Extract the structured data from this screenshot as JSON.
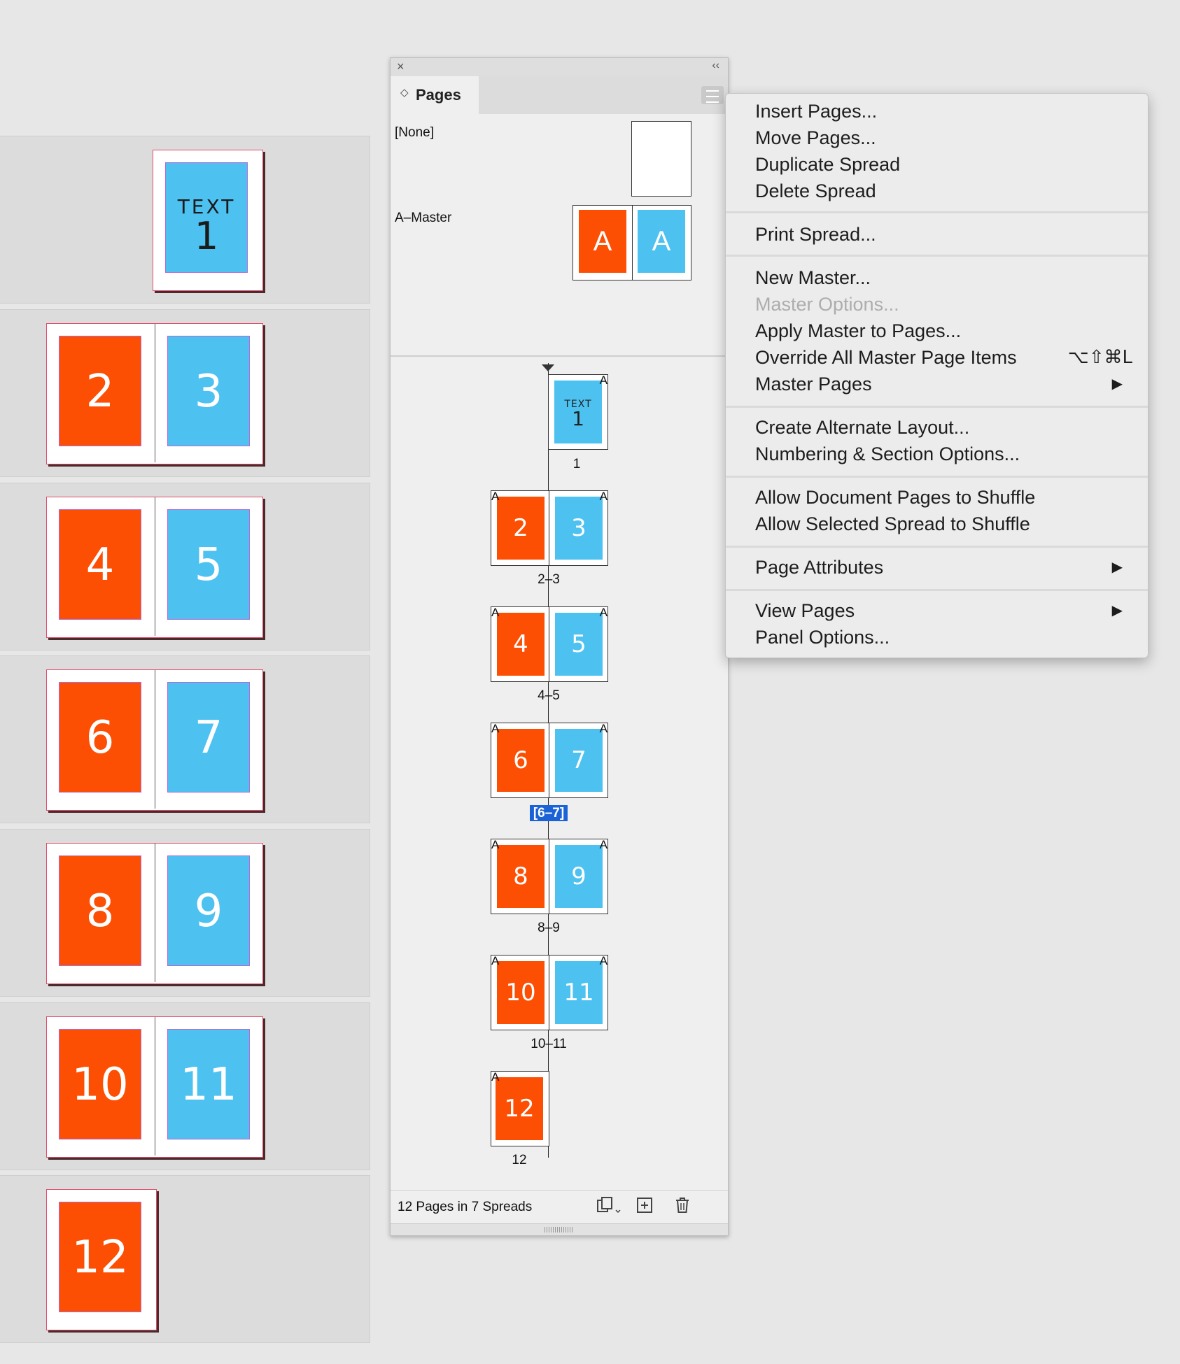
{
  "canvas": {
    "spreads": [
      {
        "pages": [
          {
            "type": "text",
            "line1": "TEXT",
            "line2": "1",
            "color": "blue"
          }
        ]
      },
      {
        "pages": [
          {
            "label": "2",
            "color": "orange"
          },
          {
            "label": "3",
            "color": "blue"
          }
        ]
      },
      {
        "pages": [
          {
            "label": "4",
            "color": "orange"
          },
          {
            "label": "5",
            "color": "blue"
          }
        ]
      },
      {
        "pages": [
          {
            "label": "6",
            "color": "orange"
          },
          {
            "label": "7",
            "color": "blue"
          }
        ]
      },
      {
        "pages": [
          {
            "label": "8",
            "color": "orange"
          },
          {
            "label": "9",
            "color": "blue"
          }
        ]
      },
      {
        "pages": [
          {
            "label": "10",
            "color": "orange"
          },
          {
            "label": "11",
            "color": "blue"
          }
        ]
      },
      {
        "pages": [
          {
            "label": "12",
            "color": "orange"
          }
        ]
      }
    ]
  },
  "colors": {
    "orange": "#fd4f04",
    "blue": "#4dc1ef",
    "selection": "#1a62d6"
  },
  "panel": {
    "close": "×",
    "collapse": "‹‹",
    "tab_arrows": "◇",
    "tab_label": "Pages",
    "none_label": "[None]",
    "master_label": "A–Master",
    "master_left": "A",
    "master_right": "A",
    "master_letter": "A",
    "thumb_text": "TEXT",
    "spreads": [
      {
        "left": "",
        "right": "1",
        "label": "1",
        "selected": false
      },
      {
        "left": "2",
        "right": "3",
        "label": "2–3",
        "selected": false
      },
      {
        "left": "4",
        "right": "5",
        "label": "4–5",
        "selected": false
      },
      {
        "left": "6",
        "right": "7",
        "label": "[6–7]",
        "selected": true
      },
      {
        "left": "8",
        "right": "9",
        "label": "8–9",
        "selected": false
      },
      {
        "left": "10",
        "right": "11",
        "label": "10–11",
        "selected": false
      },
      {
        "left": "12",
        "right": "",
        "label": "12",
        "selected": false
      }
    ],
    "footer_count": "12 Pages in 7 Spreads"
  },
  "menu": {
    "items": [
      {
        "label": "Insert Pages..."
      },
      {
        "label": "Move Pages..."
      },
      {
        "label": "Duplicate Spread"
      },
      {
        "label": "Delete Spread"
      },
      {
        "label": "Print Spread..."
      },
      {
        "label": "New Master..."
      },
      {
        "label": "Master Options...",
        "disabled": true
      },
      {
        "label": "Apply Master to Pages..."
      },
      {
        "label": "Override All Master Page Items",
        "shortcut": "⌥⇧⌘L"
      },
      {
        "label": "Master Pages",
        "submenu": true
      },
      {
        "label": "Create Alternate Layout..."
      },
      {
        "label": "Numbering & Section Options..."
      },
      {
        "label": "Allow Document Pages to Shuffle"
      },
      {
        "label": "Allow Selected Spread to Shuffle"
      },
      {
        "label": "Page Attributes",
        "submenu": true
      },
      {
        "label": "View Pages",
        "submenu": true
      },
      {
        "label": "Panel Options..."
      }
    ],
    "submenu_arrow": "▶"
  }
}
